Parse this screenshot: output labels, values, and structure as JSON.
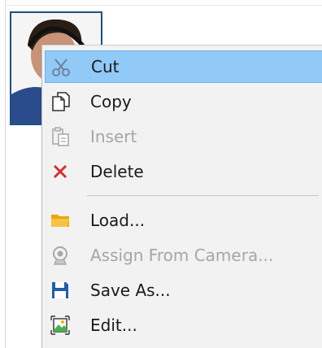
{
  "menu": {
    "items": [
      {
        "label": "Cut",
        "icon": "scissors-icon",
        "enabled": true,
        "highlighted": true
      },
      {
        "label": "Copy",
        "icon": "copy-icon",
        "enabled": true
      },
      {
        "label": "Insert",
        "icon": "paste-icon",
        "enabled": false
      },
      {
        "label": "Delete",
        "icon": "delete-x-icon",
        "enabled": true
      },
      {
        "label": "Load...",
        "icon": "folder-icon",
        "enabled": true
      },
      {
        "label": "Assign From Camera...",
        "icon": "camera-icon",
        "enabled": false
      },
      {
        "label": "Save As...",
        "icon": "save-icon",
        "enabled": true
      },
      {
        "label": "Edit...",
        "icon": "edit-image-icon",
        "enabled": true
      }
    ]
  },
  "colors": {
    "highlight": "#91c9f7",
    "delete": "#d32f2f",
    "folder": "#f4b400",
    "save": "#1f5fa8",
    "photo_border": "#1c4f86"
  }
}
